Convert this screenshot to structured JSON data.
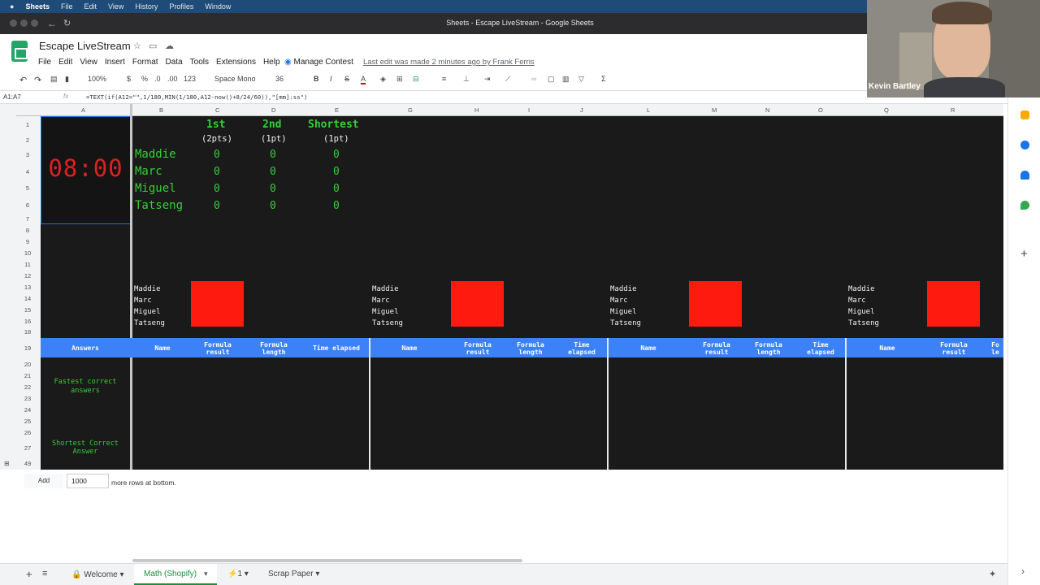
{
  "mac_menubar": {
    "app": "Sheets",
    "items": [
      "File",
      "Edit",
      "View",
      "History",
      "Profiles",
      "Window"
    ]
  },
  "window": {
    "title": "Sheets - Escape LiveStream - Google Sheets"
  },
  "doc": {
    "name": "Escape LiveStream",
    "last_edit": "Last edit was made 2 minutes ago by Frank Ferris",
    "manage_contest": "Manage Contest"
  },
  "menu": [
    "File",
    "Edit",
    "View",
    "Insert",
    "Format",
    "Data",
    "Tools",
    "Extensions",
    "Help"
  ],
  "toolbar": {
    "zoom": "100%",
    "currency": "$",
    "percent": "%",
    "dec_dec": ".0",
    "inc_dec": ".00",
    "format": "123",
    "font": "Space Mono",
    "size": "36",
    "bold": "B",
    "italic": "I",
    "strike": "S",
    "textcolor": "A",
    "sigma": "Σ"
  },
  "formula_bar": {
    "name_box": "A1:A7",
    "fx": "fx",
    "formula": "=TEXT(if(A12=\"\",1/180,MIN(1/180,A12-now()+8/24/60)),\"[mm]:ss\")"
  },
  "columns": [
    "A",
    "B",
    "C",
    "D",
    "E",
    "G",
    "H",
    "I",
    "J",
    "L",
    "M",
    "N",
    "O",
    "Q",
    "R"
  ],
  "rows": [
    "1",
    "2",
    "3",
    "4",
    "5",
    "6",
    "7",
    "8",
    "9",
    "10",
    "11",
    "12",
    "13",
    "14",
    "15",
    "16",
    "18",
    "19",
    "20",
    "21",
    "22",
    "23",
    "24",
    "25",
    "26",
    "27",
    "49"
  ],
  "timer": "08:00",
  "scoreboard": {
    "headers": [
      "1st",
      "2nd",
      "Shortest"
    ],
    "subheaders": [
      "(2pts)",
      "(1pt)",
      "(1pt)"
    ],
    "players": [
      {
        "name": "Maddie",
        "v": [
          "0",
          "0",
          "0"
        ]
      },
      {
        "name": "Marc",
        "v": [
          "0",
          "0",
          "0"
        ]
      },
      {
        "name": "Miguel",
        "v": [
          "0",
          "0",
          "0"
        ]
      },
      {
        "name": "Tatseng",
        "v": [
          "0",
          "0",
          "0"
        ]
      }
    ]
  },
  "groups": [
    {
      "names": [
        "Maddie",
        "Marc",
        "Miguel",
        "Tatseng"
      ]
    },
    {
      "names": [
        "Maddie",
        "Marc",
        "Miguel",
        "Tatseng"
      ]
    },
    {
      "names": [
        "Maddie",
        "Marc",
        "Miguel",
        "Tatseng"
      ]
    },
    {
      "names": [
        "Maddie",
        "Marc",
        "Miguel",
        "Tatseng"
      ]
    }
  ],
  "table_header": {
    "answers": "Answers",
    "g1": [
      "Name",
      "Formula result",
      "Formula length",
      "Time elapsed"
    ],
    "g2": [
      "Name",
      "Formula result",
      "Formula length",
      "Time elapsed"
    ],
    "g3": [
      "Name",
      "Formula result",
      "Formula length",
      "Time elapsed"
    ],
    "g4": [
      "Name",
      "Formula result",
      "Fo le"
    ]
  },
  "labels": {
    "fastest": "Fastest correct answers",
    "shortest": "Shortest Correct Answer"
  },
  "add_rows": {
    "button": "Add",
    "count": "1000",
    "text": "more rows at bottom."
  },
  "tabs": [
    "Welcome",
    "Math (Shopify)",
    "⚡1",
    "Scrap Paper"
  ],
  "webcam": {
    "name": "Kevin Bartley"
  }
}
